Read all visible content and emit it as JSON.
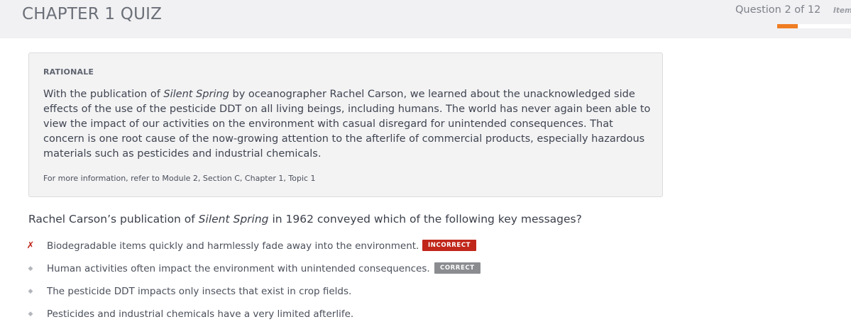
{
  "header": {
    "title": "CHAPTER 1 QUIZ",
    "question_counter": "Question 2 of 12",
    "item_label": "Item",
    "progress_fraction": 0.28
  },
  "rationale": {
    "heading": "RATIONALE",
    "body_pre": "With the publication of ",
    "body_italic": "Silent Spring",
    "body_post": " by oceanographer Rachel Carson, we learned about the unacknowledged side effects of the use of the pesticide DDT on all living beings, including humans. The world has never again been able to view the impact of our activities on the environment with casual disregard for unintended consequences. That concern is one root cause of the now-growing attention to the afterlife of commercial products, especially hazardous materials such as pesticides and industrial chemicals.",
    "more_info": "For more information, refer to Module 2, Section C, Chapter 1, Topic 1"
  },
  "question": {
    "pre": "Rachel Carson’s publication of ",
    "italic": "Silent Spring",
    "post": " in 1962 conveyed which of the following key messages?"
  },
  "answers": [
    {
      "marker": "✗",
      "marker_icon": "x-mark-icon",
      "text": "Biodegradable items quickly and harmlessly fade away into the environment.",
      "badge": "INCORRECT"
    },
    {
      "marker": "◆",
      "marker_icon": "diamond-bullet-icon",
      "text": "Human activities often impact the environment with unintended consequences.",
      "badge": "CORRECT"
    },
    {
      "marker": "◆",
      "marker_icon": "diamond-bullet-icon",
      "text": "The pesticide DDT impacts only insects that exist in crop fields.",
      "badge": ""
    },
    {
      "marker": "◆",
      "marker_icon": "diamond-bullet-icon",
      "text": "Pesticides and industrial chemicals have a very limited afterlife.",
      "badge": ""
    }
  ],
  "colors": {
    "accent_orange": "#ef7d22",
    "incorrect_red": "#c0271a",
    "correct_gray": "#8a8c90"
  }
}
